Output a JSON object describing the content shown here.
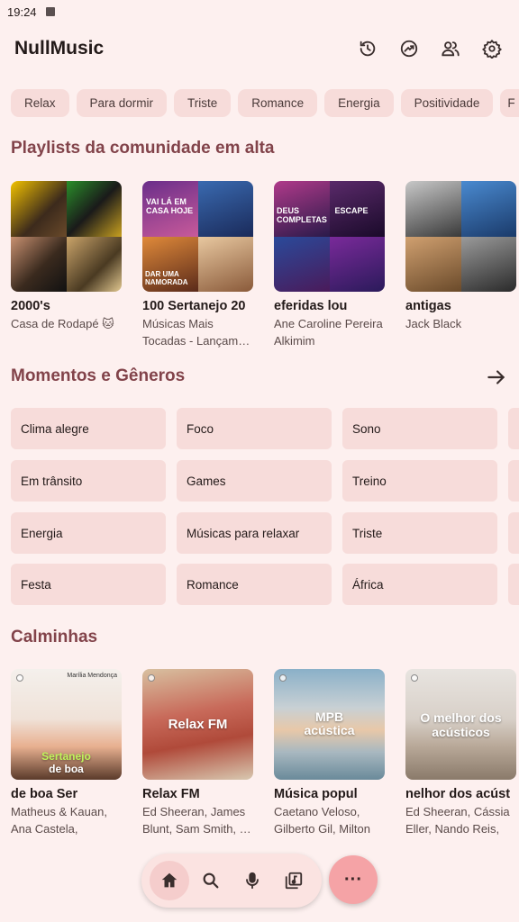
{
  "status": {
    "time": "19:24"
  },
  "app": {
    "title": "NullMusic"
  },
  "chips": [
    "Relax",
    "Para dormir",
    "Triste",
    "Romance",
    "Energia",
    "Positividade"
  ],
  "sections": {
    "community": "Playlists da comunidade em alta",
    "moods": "Momentos e Gêneros",
    "calm": "Calminhas"
  },
  "community": [
    {
      "title": "2000's",
      "subtitle": "Casa de Rodapé 🐱"
    },
    {
      "title": "100 Sertanejo 20",
      "subtitle": "Músicas Mais Tocadas - Lançam…",
      "art_text": "VAI LÁ EM CASA HOJE",
      "art_text2": "DAR UMA NAMORADA"
    },
    {
      "title": "eferidas       lou",
      "subtitle": "Ane Caroline Pereira Alkimim",
      "art_text": "DEUS COMPLETAS",
      "art_text2": "ESCAPE"
    },
    {
      "title": "antigas",
      "subtitle": "Jack Black"
    }
  ],
  "moods": [
    [
      "Clima alegre",
      "Foco",
      "Sono"
    ],
    [
      "Em trânsito",
      "Games",
      "Treino"
    ],
    [
      "Energia",
      "Músicas para relaxar",
      "Triste"
    ],
    [
      "Festa",
      "Romance",
      "África"
    ]
  ],
  "calm": [
    {
      "title": " de boa         Ser",
      "subtitle": "Matheus & Kauan, Ana Castela, Lauan…",
      "art_label": "Sertanejo",
      "art_label2": "de boa",
      "art_top": "Marília Mendonça"
    },
    {
      "title": "Relax FM",
      "subtitle": "Ed Sheeran, James Blunt, Sam Smith, …",
      "art_label": "Relax FM"
    },
    {
      "title": "Música popul",
      "subtitle": "Caetano Veloso, Gilberto Gil, Milton …",
      "art_label": "MPB acústica"
    },
    {
      "title": "nelhor dos acúst",
      "subtitle": "Ed Sheeran, Cássia Eller, Nando Reis, L…",
      "art_label": "O melhor dos acústicos"
    }
  ],
  "fab": {
    "label": "···"
  },
  "icons": [
    "history-icon",
    "trending-icon",
    "people-icon",
    "settings-icon",
    "arrow-right-icon",
    "home-icon",
    "search-icon",
    "mic-icon",
    "library-icon"
  ],
  "colors": {
    "background": "#fdf0ef",
    "chip": "#f7dcda",
    "accent_title": "#82434a",
    "fab": "#f5a3a6"
  }
}
